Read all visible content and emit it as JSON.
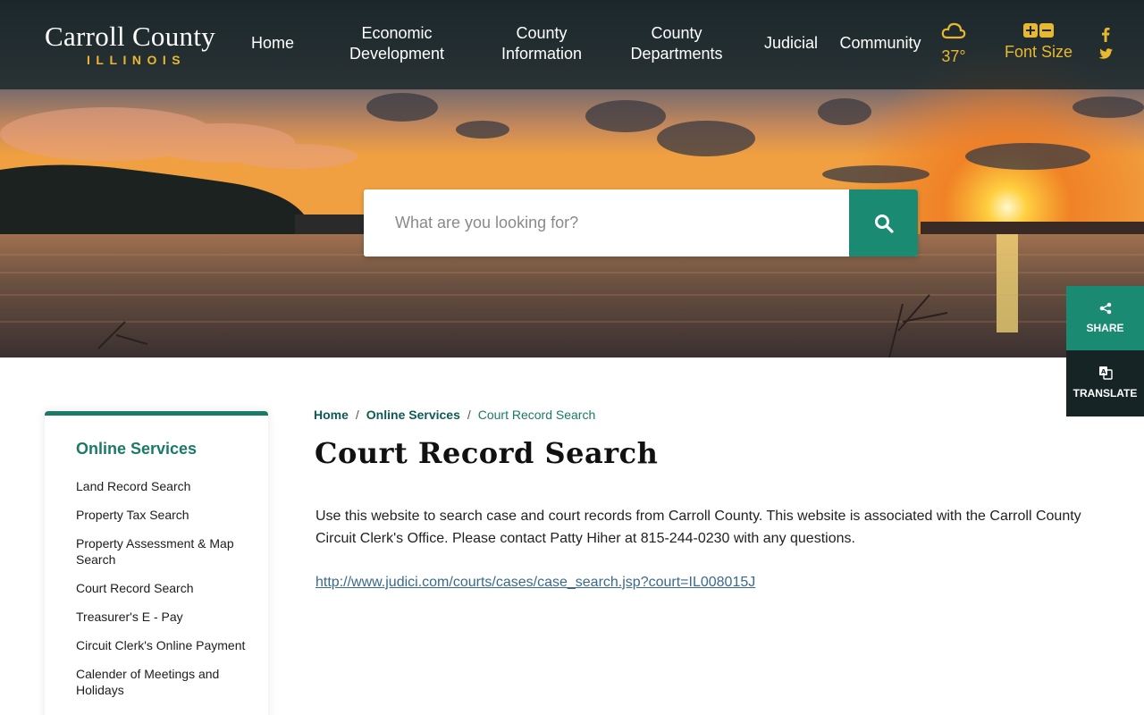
{
  "header": {
    "logo_main": "Carroll County",
    "logo_sub": "ILLINOIS",
    "nav": [
      {
        "line1": "Home",
        "line2": ""
      },
      {
        "line1": "Economic",
        "line2": "Development"
      },
      {
        "line1": "County",
        "line2": "Information"
      },
      {
        "line1": "County",
        "line2": "Departments"
      },
      {
        "line1": "Judicial",
        "line2": ""
      },
      {
        "line1": "Community",
        "line2": ""
      }
    ],
    "weather": {
      "icon": "cloud-icon",
      "temp": "37°"
    },
    "font_size": {
      "label": "Font Size"
    },
    "social": [
      {
        "icon": "facebook-icon",
        "glyph": "f"
      },
      {
        "icon": "twitter-icon",
        "glyph": "t"
      }
    ]
  },
  "search": {
    "placeholder": "What are you looking for?"
  },
  "floating": {
    "share": "SHARE",
    "translate": "TRANSLATE"
  },
  "sidebar": {
    "title": "Online Services",
    "items": [
      "Land Record Search",
      "Property Tax Search",
      "Property Assessment & Map Search",
      "Court Record Search",
      "Treasurer's E - Pay",
      "Circuit Clerk's Online Payment",
      "Calender of Meetings and Holidays"
    ]
  },
  "breadcrumb": {
    "home": "Home",
    "section": "Online Services",
    "current": "Court Record Search",
    "sep": "/"
  },
  "main": {
    "title": "Court Record Search",
    "body": "Use this website to search case and court records from Carroll County.  This website is associated with the Carroll County Circuit Clerk's Office.  Please contact Patty Hiher at 815-244-0230 with any questions.",
    "link": "http://www.judici.com/courts/cases/case_search.jsp?court=IL008015J"
  },
  "colors": {
    "accent": "#1a8a73",
    "gold": "#e8b830",
    "dark": "#162426"
  }
}
